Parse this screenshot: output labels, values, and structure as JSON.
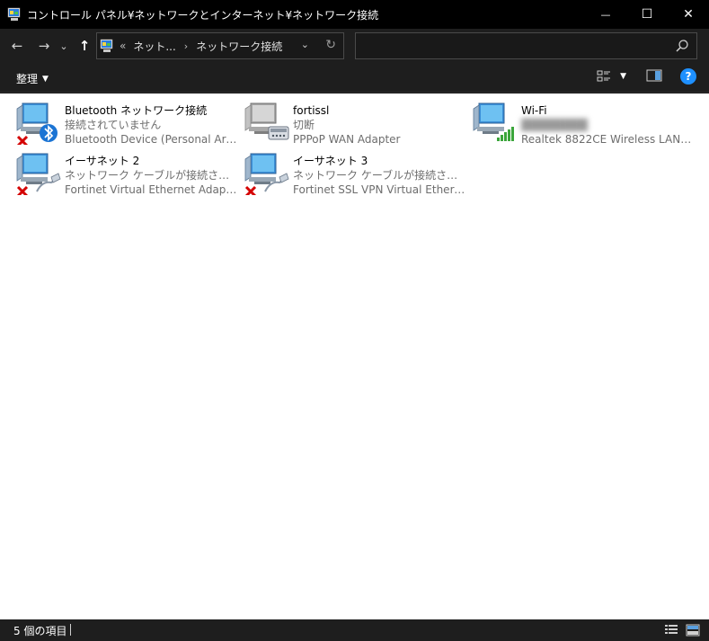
{
  "window": {
    "title": "コントロール パネル¥ネットワークとインターネット¥ネットワーク接続",
    "minimize_glyph": "—",
    "maximize_glyph": "☐",
    "close_glyph": "✕"
  },
  "nav": {
    "back_glyph": "←",
    "forward_glyph": "→",
    "recent_glyph": "⌄",
    "up_glyph": "↑"
  },
  "address": {
    "prefix": "«",
    "crumbs": [
      "ネット...",
      "ネットワーク接続"
    ],
    "separator": "›",
    "dropdown_glyph": "⌄",
    "refresh_glyph": "↻"
  },
  "search": {
    "value": "",
    "placeholder": ""
  },
  "commandbar": {
    "organize_label": "整理",
    "organize_caret": "▼",
    "view_caret": "▼",
    "help_glyph": "?"
  },
  "connections": [
    {
      "name": "Bluetooth ネットワーク接続",
      "status": "接続されていません",
      "device": "Bluetooth Device (Personal Area ...",
      "icon": "bluetooth-adapter-icon",
      "badge": "disconnected-x-icon"
    },
    {
      "name": "fortissl",
      "status": "切断",
      "device": "PPPoP WAN Adapter",
      "icon": "dialup-modem-icon",
      "badge": ""
    },
    {
      "name": "Wi-Fi",
      "status": "████████",
      "device": "Realtek 8822CE Wireless LAN 802....",
      "icon": "wifi-signal-icon",
      "badge": ""
    },
    {
      "name": "イーサネット 2",
      "status": "ネットワーク ケーブルが接続されていま...",
      "device": "Fortinet Virtual Ethernet Adapter (...",
      "icon": "ethernet-cable-icon",
      "badge": "disconnected-x-icon"
    },
    {
      "name": "イーサネット 3",
      "status": "ネットワーク ケーブルが接続されていま...",
      "device": "Fortinet SSL VPN Virtual Ethernet ...",
      "icon": "ethernet-cable-icon",
      "badge": "disconnected-x-icon"
    }
  ],
  "statusbar": {
    "item_count": "5 個の項目"
  },
  "colors": {
    "titlebar": "#000000",
    "chrome": "#1e1e1e",
    "content": "#ffffff",
    "help": "#1e90ff",
    "wifi": "#3aa53a",
    "x": "#d40000"
  }
}
